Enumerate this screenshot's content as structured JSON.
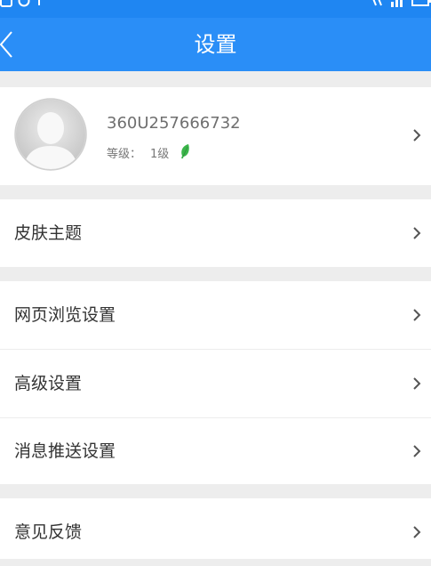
{
  "screen_title": "设置",
  "profile": {
    "username": "360U257666732",
    "level_label": "等级：",
    "level_value": "1级"
  },
  "menu": {
    "skin_theme": "皮肤主题",
    "web_browse_settings": "网页浏览设置",
    "advanced_settings": "高级设置",
    "push_settings": "消息推送设置",
    "feedback": "意见反馈"
  },
  "colors": {
    "header": "#2a8ef7",
    "status_bar": "#1f86f2",
    "page_background": "#ededed",
    "level_leaf": "#3ab54a"
  },
  "icons": {
    "back": "chevron-left-icon",
    "row_arrow": "chevron-right-icon",
    "avatar": "default-avatar",
    "level": "leaf-icon"
  }
}
